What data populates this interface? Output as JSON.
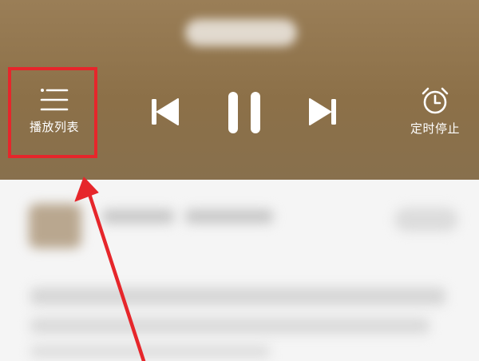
{
  "player": {
    "playlist_label": "播放列表",
    "timer_label": "定时停止"
  },
  "icons": {
    "playlist": "playlist-icon",
    "previous": "skip-previous-icon",
    "pause": "pause-icon",
    "next": "skip-next-icon",
    "timer": "alarm-clock-icon"
  },
  "colors": {
    "player_background": "#8c7048",
    "highlight": "#e6262b",
    "icon": "#ffffff"
  }
}
